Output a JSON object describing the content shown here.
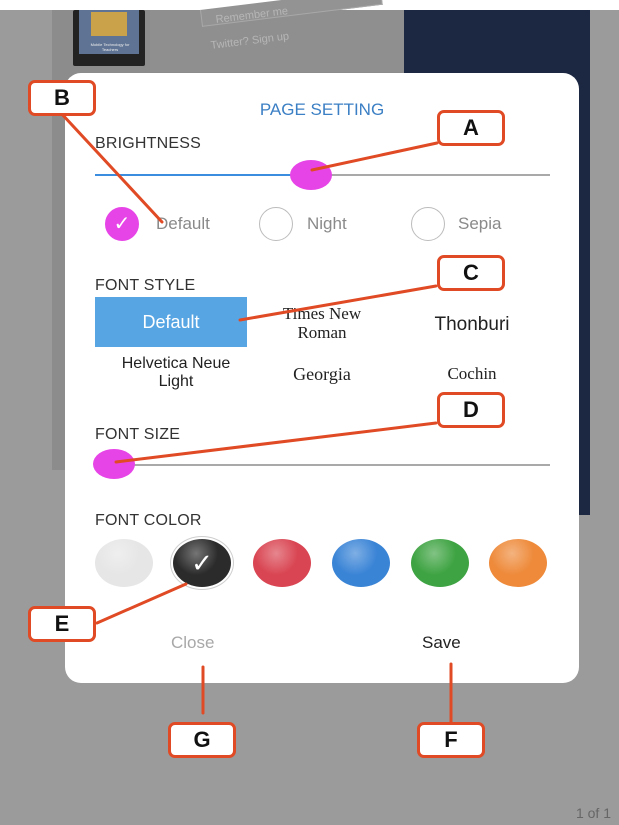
{
  "background": {
    "faint_text_1": "Remember me",
    "faint_text_2": "Twitter? Sign up",
    "tablet_caption": "Mobile Technology for Teachers",
    "page_indicator": "1 of 1"
  },
  "dialog": {
    "title": "PAGE SETTING",
    "brightness": {
      "label": "BRIGHTNESS",
      "value": 0.45,
      "modes": [
        {
          "label": "Default",
          "selected": true
        },
        {
          "label": "Night",
          "selected": false
        },
        {
          "label": "Sepia",
          "selected": false
        }
      ]
    },
    "font_style": {
      "label": "FONT STYLE",
      "options": [
        {
          "label": "Default",
          "selected": true
        },
        {
          "label": "Times New Roman",
          "selected": false
        },
        {
          "label": "Thonburi",
          "selected": false
        },
        {
          "label": "Helvetica Neue Light",
          "selected": false
        },
        {
          "label": "Georgia",
          "selected": false
        },
        {
          "label": "Cochin",
          "selected": false
        }
      ]
    },
    "font_size": {
      "label": "FONT SIZE",
      "value": 0.0
    },
    "font_color": {
      "label": "FONT COLOR",
      "swatches": [
        {
          "color": "#e6e6e6",
          "selected": false
        },
        {
          "color": "#2b2b2b",
          "selected": true
        },
        {
          "color": "#d94552",
          "selected": false
        },
        {
          "color": "#3a84d6",
          "selected": false
        },
        {
          "color": "#3ea342",
          "selected": false
        },
        {
          "color": "#ee8a3a",
          "selected": false
        }
      ]
    },
    "close_label": "Close",
    "save_label": "Save"
  },
  "callouts": [
    "A",
    "B",
    "C",
    "D",
    "E",
    "F",
    "G"
  ],
  "colors": {
    "accent_magenta": "#e744e7",
    "title_blue": "#3b7fc4",
    "callout_red": "#e04a24",
    "selected_blue": "#58a5e3"
  }
}
